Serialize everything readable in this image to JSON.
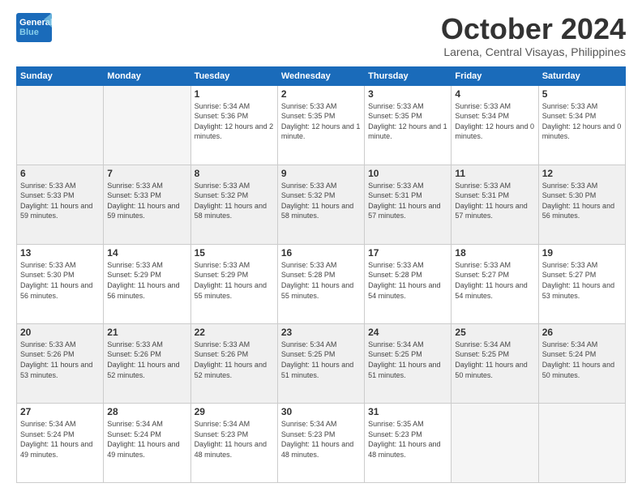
{
  "logo": {
    "general": "General",
    "blue": "Blue"
  },
  "header": {
    "month": "October 2024",
    "location": "Larena, Central Visayas, Philippines"
  },
  "weekdays": [
    "Sunday",
    "Monday",
    "Tuesday",
    "Wednesday",
    "Thursday",
    "Friday",
    "Saturday"
  ],
  "days": [
    {
      "date": null,
      "info": ""
    },
    {
      "date": null,
      "info": ""
    },
    {
      "date": "1",
      "sunrise": "5:34 AM",
      "sunset": "5:36 PM",
      "daylight": "12 hours and 2 minutes."
    },
    {
      "date": "2",
      "sunrise": "5:33 AM",
      "sunset": "5:35 PM",
      "daylight": "12 hours and 1 minute."
    },
    {
      "date": "3",
      "sunrise": "5:33 AM",
      "sunset": "5:35 PM",
      "daylight": "12 hours and 1 minute."
    },
    {
      "date": "4",
      "sunrise": "5:33 AM",
      "sunset": "5:34 PM",
      "daylight": "12 hours and 0 minutes."
    },
    {
      "date": "5",
      "sunrise": "5:33 AM",
      "sunset": "5:34 PM",
      "daylight": "12 hours and 0 minutes."
    },
    {
      "date": "6",
      "sunrise": "5:33 AM",
      "sunset": "5:33 PM",
      "daylight": "11 hours and 59 minutes."
    },
    {
      "date": "7",
      "sunrise": "5:33 AM",
      "sunset": "5:33 PM",
      "daylight": "11 hours and 59 minutes."
    },
    {
      "date": "8",
      "sunrise": "5:33 AM",
      "sunset": "5:32 PM",
      "daylight": "11 hours and 58 minutes."
    },
    {
      "date": "9",
      "sunrise": "5:33 AM",
      "sunset": "5:32 PM",
      "daylight": "11 hours and 58 minutes."
    },
    {
      "date": "10",
      "sunrise": "5:33 AM",
      "sunset": "5:31 PM",
      "daylight": "11 hours and 57 minutes."
    },
    {
      "date": "11",
      "sunrise": "5:33 AM",
      "sunset": "5:31 PM",
      "daylight": "11 hours and 57 minutes."
    },
    {
      "date": "12",
      "sunrise": "5:33 AM",
      "sunset": "5:30 PM",
      "daylight": "11 hours and 56 minutes."
    },
    {
      "date": "13",
      "sunrise": "5:33 AM",
      "sunset": "5:30 PM",
      "daylight": "11 hours and 56 minutes."
    },
    {
      "date": "14",
      "sunrise": "5:33 AM",
      "sunset": "5:29 PM",
      "daylight": "11 hours and 56 minutes."
    },
    {
      "date": "15",
      "sunrise": "5:33 AM",
      "sunset": "5:29 PM",
      "daylight": "11 hours and 55 minutes."
    },
    {
      "date": "16",
      "sunrise": "5:33 AM",
      "sunset": "5:28 PM",
      "daylight": "11 hours and 55 minutes."
    },
    {
      "date": "17",
      "sunrise": "5:33 AM",
      "sunset": "5:28 PM",
      "daylight": "11 hours and 54 minutes."
    },
    {
      "date": "18",
      "sunrise": "5:33 AM",
      "sunset": "5:27 PM",
      "daylight": "11 hours and 54 minutes."
    },
    {
      "date": "19",
      "sunrise": "5:33 AM",
      "sunset": "5:27 PM",
      "daylight": "11 hours and 53 minutes."
    },
    {
      "date": "20",
      "sunrise": "5:33 AM",
      "sunset": "5:26 PM",
      "daylight": "11 hours and 53 minutes."
    },
    {
      "date": "21",
      "sunrise": "5:33 AM",
      "sunset": "5:26 PM",
      "daylight": "11 hours and 52 minutes."
    },
    {
      "date": "22",
      "sunrise": "5:33 AM",
      "sunset": "5:26 PM",
      "daylight": "11 hours and 52 minutes."
    },
    {
      "date": "23",
      "sunrise": "5:34 AM",
      "sunset": "5:25 PM",
      "daylight": "11 hours and 51 minutes."
    },
    {
      "date": "24",
      "sunrise": "5:34 AM",
      "sunset": "5:25 PM",
      "daylight": "11 hours and 51 minutes."
    },
    {
      "date": "25",
      "sunrise": "5:34 AM",
      "sunset": "5:25 PM",
      "daylight": "11 hours and 50 minutes."
    },
    {
      "date": "26",
      "sunrise": "5:34 AM",
      "sunset": "5:24 PM",
      "daylight": "11 hours and 50 minutes."
    },
    {
      "date": "27",
      "sunrise": "5:34 AM",
      "sunset": "5:24 PM",
      "daylight": "11 hours and 49 minutes."
    },
    {
      "date": "28",
      "sunrise": "5:34 AM",
      "sunset": "5:24 PM",
      "daylight": "11 hours and 49 minutes."
    },
    {
      "date": "29",
      "sunrise": "5:34 AM",
      "sunset": "5:23 PM",
      "daylight": "11 hours and 48 minutes."
    },
    {
      "date": "30",
      "sunrise": "5:34 AM",
      "sunset": "5:23 PM",
      "daylight": "11 hours and 48 minutes."
    },
    {
      "date": "31",
      "sunrise": "5:35 AM",
      "sunset": "5:23 PM",
      "daylight": "11 hours and 48 minutes."
    },
    {
      "date": null,
      "info": ""
    },
    {
      "date": null,
      "info": ""
    },
    {
      "date": null,
      "info": ""
    }
  ],
  "labels": {
    "sunrise": "Sunrise:",
    "sunset": "Sunset:",
    "daylight": "Daylight:"
  }
}
